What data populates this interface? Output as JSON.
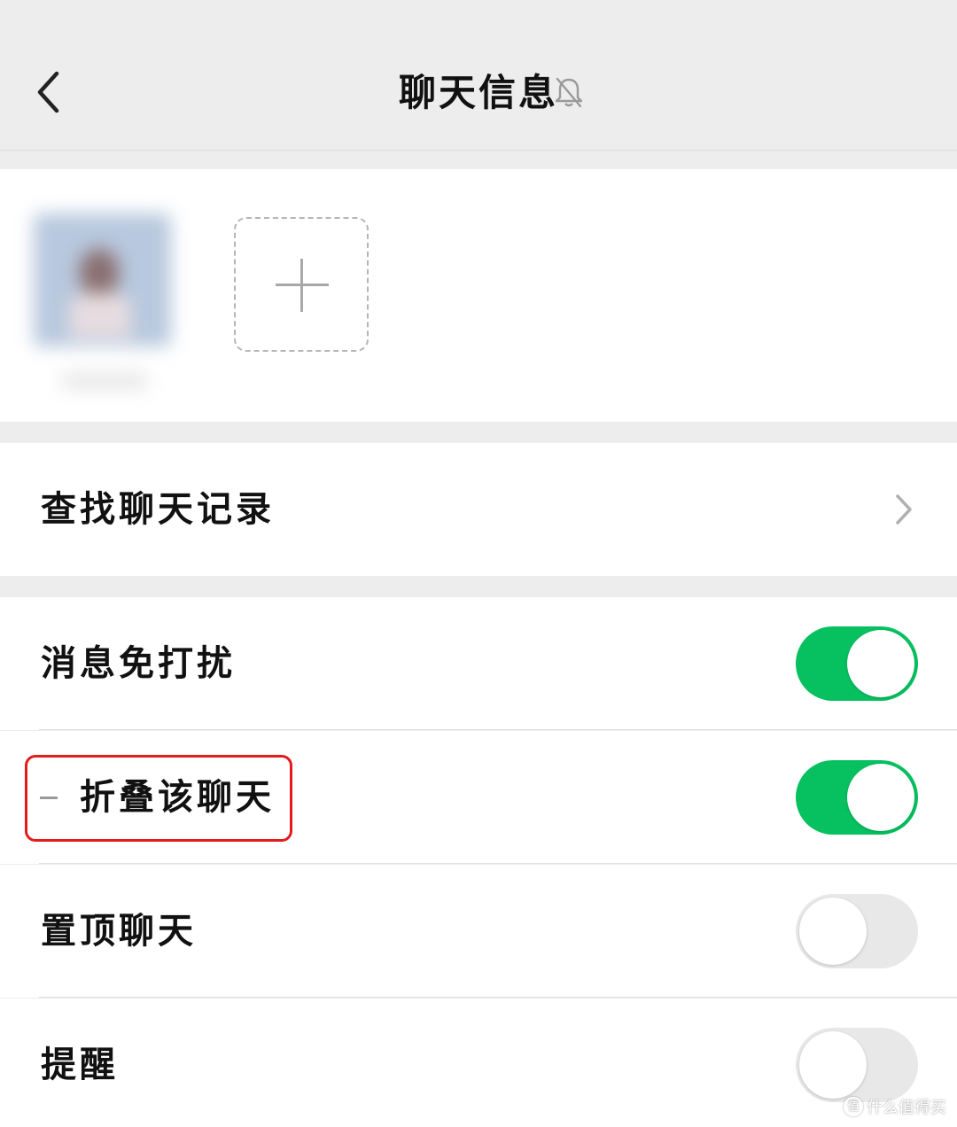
{
  "header": {
    "title": "聊天信息",
    "back_icon": "chevron-left-icon",
    "mute_icon": "bell-off-icon"
  },
  "members": {
    "add_icon": "plus-icon"
  },
  "search_row": {
    "label": "查找聊天记录",
    "icon": "chevron-right-icon"
  },
  "settings": [
    {
      "label": "消息免打扰",
      "on": true
    },
    {
      "label": "折叠该聊天",
      "on": true
    },
    {
      "label": "置顶聊天",
      "on": false
    },
    {
      "label": "提醒",
      "on": false
    }
  ],
  "colors": {
    "accent_green": "#07c160",
    "highlight_red": "#e31b1b",
    "background": "#ededed"
  },
  "watermark": {
    "text": "什么值得买",
    "logo": "值"
  }
}
